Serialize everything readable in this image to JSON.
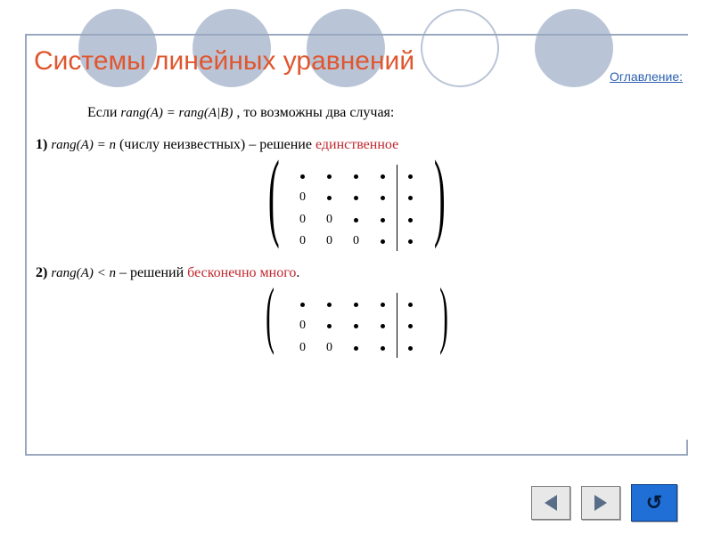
{
  "title": "Системы линейных уравнений",
  "toc_link": "Оглавление:",
  "intro": {
    "prefix": "Если ",
    "formula": "rang(A) = rang(A|B)",
    "suffix": ", то возможны два случая:"
  },
  "case1": {
    "num": "1)",
    "formula": "rang(A) = n",
    "text_plain": " (числу неизвестных) – решение ",
    "text_red": "единственное"
  },
  "case2": {
    "num": "2)",
    "formula": "rang(A) < n",
    "text_plain": " – решений ",
    "text_red": "бесконечно много",
    "dot": "."
  },
  "matrix1": {
    "rows": 4,
    "left_cols": 4,
    "aug_cols": 1,
    "cells": [
      [
        "•",
        "•",
        "•",
        "•",
        "•"
      ],
      [
        "0",
        "•",
        "•",
        "•",
        "•"
      ],
      [
        "0",
        "0",
        "•",
        "•",
        "•"
      ],
      [
        "0",
        "0",
        "0",
        "•",
        "•"
      ]
    ]
  },
  "matrix2": {
    "rows": 3,
    "left_cols": 4,
    "aug_cols": 1,
    "cells": [
      [
        "•",
        "•",
        "•",
        "•",
        "•"
      ],
      [
        "0",
        "•",
        "•",
        "•",
        "•"
      ],
      [
        "0",
        "0",
        "•",
        "•",
        "•"
      ]
    ]
  },
  "nav": {
    "prev": "previous-slide",
    "next": "next-slide",
    "return": "return"
  }
}
